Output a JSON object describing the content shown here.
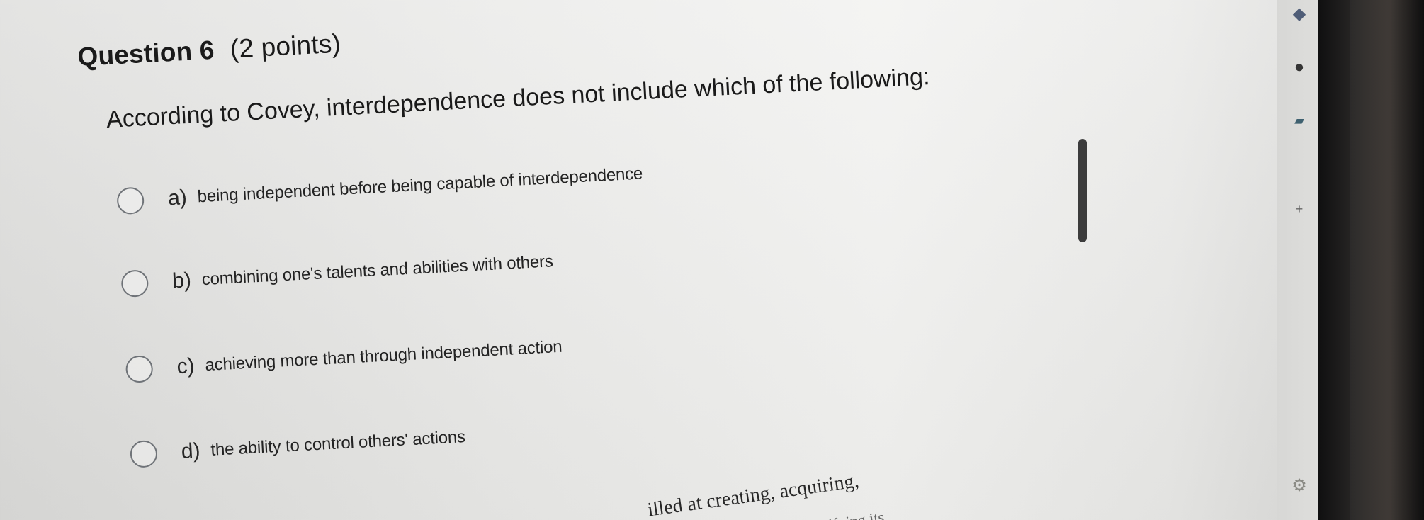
{
  "question": {
    "number_label": "Question 6",
    "points_label": "(2 points)",
    "prompt": "According to Covey, interdependence does not include which of the following:"
  },
  "options": [
    {
      "letter": "a)",
      "text": "being independent before being capable of interdependence"
    },
    {
      "letter": "b)",
      "text": "combining one's talents and abilities with others"
    },
    {
      "letter": "c)",
      "text": "achieving more than through independent action"
    },
    {
      "letter": "d)",
      "text": "the ability to control others' actions"
    }
  ],
  "background": {
    "line_1": "illed at creating, acquiring,",
    "line_2": "ifying its"
  },
  "sidebar": {
    "icons": [
      "blue-app-icon",
      "red-app-icon",
      "small-app-icon",
      "plus-icon",
      "gear-icon"
    ]
  },
  "colors": {
    "page_background": "#e8e8e6",
    "text": "#1a1a1a",
    "radio_border": "#6f7378",
    "device_edge": "#111111"
  }
}
